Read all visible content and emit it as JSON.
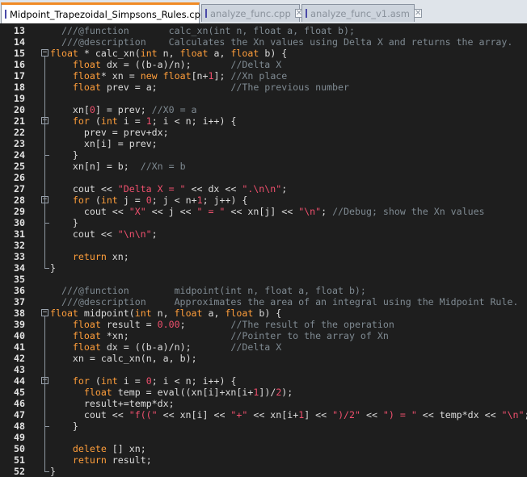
{
  "tabs": [
    {
      "label": "Midpoint_Trapezoidal_Simpsons_Rules.cpp",
      "active": true
    },
    {
      "label": "analyze_func.cpp",
      "active": false
    },
    {
      "label": "analyze_func_v1.asm",
      "active": false
    }
  ],
  "colors": {
    "keyword": "#ff9e3b",
    "comment": "#7f8a92",
    "string": "#f0506e",
    "default_text": "#dcdcdc",
    "background": "#1e1e1e",
    "active_tab_accent": "#f08a24"
  },
  "code_lines": [
    {
      "n": "13",
      "text": "  ///@function       calc_xn(int n, float a, float b);"
    },
    {
      "n": "14",
      "text": "  ///@description    Calculates the Xn values using Delta X and returns the array."
    },
    {
      "n": "15",
      "text": "float * calc_xn(int n, float a, float b) {",
      "fold": "open"
    },
    {
      "n": "16",
      "text": "    float dx = ((b-a)/n);       //Delta X"
    },
    {
      "n": "17",
      "text": "    float* xn = new float[n+1]; //Xn place"
    },
    {
      "n": "18",
      "text": "    float prev = a;             //The previous number"
    },
    {
      "n": "19",
      "text": ""
    },
    {
      "n": "20",
      "text": "    xn[0] = prev; //X0 = a"
    },
    {
      "n": "21",
      "text": "    for (int i = 1; i < n; i++) {",
      "fold": "open"
    },
    {
      "n": "22",
      "text": "      prev = prev+dx;"
    },
    {
      "n": "23",
      "text": "      xn[i] = prev;"
    },
    {
      "n": "24",
      "text": "    }",
      "fold": "end"
    },
    {
      "n": "25",
      "text": "    xn[n] = b;  //Xn = b"
    },
    {
      "n": "26",
      "text": ""
    },
    {
      "n": "27",
      "text": "    cout << \"Delta X = \" << dx << \".\\n\\n\";"
    },
    {
      "n": "28",
      "text": "    for (int j = 0; j < n+1; j++) {",
      "fold": "open"
    },
    {
      "n": "29",
      "text": "      cout << \"X\" << j << \" = \" << xn[j] << \"\\n\"; //Debug; show the Xn values"
    },
    {
      "n": "30",
      "text": "    }",
      "fold": "end"
    },
    {
      "n": "31",
      "text": "    cout << \"\\n\\n\";"
    },
    {
      "n": "32",
      "text": ""
    },
    {
      "n": "33",
      "text": "    return xn;"
    },
    {
      "n": "34",
      "text": "}",
      "fold": "end"
    },
    {
      "n": "35",
      "text": ""
    },
    {
      "n": "36",
      "text": "  ///@function        midpoint(int n, float a, float b);"
    },
    {
      "n": "37",
      "text": "  ///@description     Approximates the area of an integral using the Midpoint Rule."
    },
    {
      "n": "38",
      "text": "float midpoint(int n, float a, float b) {",
      "fold": "open"
    },
    {
      "n": "39",
      "text": "    float result = 0.00;        //The result of the operation"
    },
    {
      "n": "40",
      "text": "    float *xn;                  //Pointer to the array of Xn"
    },
    {
      "n": "41",
      "text": "    float dx = ((b-a)/n);       //Delta X"
    },
    {
      "n": "42",
      "text": "    xn = calc_xn(n, a, b);"
    },
    {
      "n": "43",
      "text": ""
    },
    {
      "n": "44",
      "text": "    for (int i = 0; i < n; i++) {",
      "fold": "open"
    },
    {
      "n": "45",
      "text": "      float temp = eval((xn[i]+xn[i+1])/2);"
    },
    {
      "n": "46",
      "text": "      result+=temp*dx;"
    },
    {
      "n": "47",
      "text": "      cout << \"f((\" << xn[i] << \"+\" << xn[i+1] << \")/2\" << \") = \" << temp*dx << \"\\n\";"
    },
    {
      "n": "48",
      "text": "    }",
      "fold": "end"
    },
    {
      "n": "49",
      "text": ""
    },
    {
      "n": "50",
      "text": "    delete [] xn;"
    },
    {
      "n": "51",
      "text": "    return result;"
    },
    {
      "n": "52",
      "text": "}",
      "fold": "end"
    }
  ]
}
